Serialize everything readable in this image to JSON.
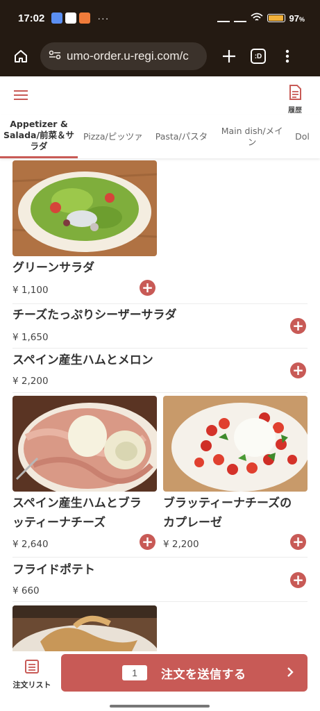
{
  "status_bar": {
    "time": "17:02",
    "battery_text": "97",
    "battery_unit": "%",
    "battery_level": 0.97,
    "overflow": "···"
  },
  "browser": {
    "url": "umo-order.u-regi.com/c",
    "tabs_count": ":D"
  },
  "header": {
    "history_label": "履歴"
  },
  "categories": [
    {
      "label": "Appetizer & Salada/前菜＆サラダ",
      "active": true
    },
    {
      "label": "Pizza/ピッツァ",
      "active": false
    },
    {
      "label": "Pasta/パスタ",
      "active": false
    },
    {
      "label": "Main dish/メイン",
      "active": false
    },
    {
      "label": "Dol",
      "active": false
    }
  ],
  "menu_items": [
    {
      "name": "グリーンサラダ",
      "price": "¥ 1,100",
      "photo": "green-salad-photo"
    },
    {
      "name": "チーズたっぷりシーザーサラダ",
      "price": "¥ 1,650"
    },
    {
      "name": "スペイン産生ハムとメロン",
      "price": "¥ 2,200"
    },
    {
      "name_line1": "スペイン産生ハムとブラ",
      "name_line2": "ッティーナチーズ",
      "price": "¥ 2,640",
      "photo": "prosciutto-burrata-photo"
    },
    {
      "name_line1": "ブラッティーナチーズの",
      "name_line2": "カプレーゼ",
      "price": "¥ 2,200",
      "photo": "caprese-photo"
    },
    {
      "name": "フライドポテト",
      "price": "¥ 660"
    }
  ],
  "bottom": {
    "order_list_label": "注文リスト",
    "quantity": "1",
    "send_label": "注文を送信する"
  },
  "colors": {
    "accent": "#c85a56",
    "chrome": "#241a12"
  }
}
